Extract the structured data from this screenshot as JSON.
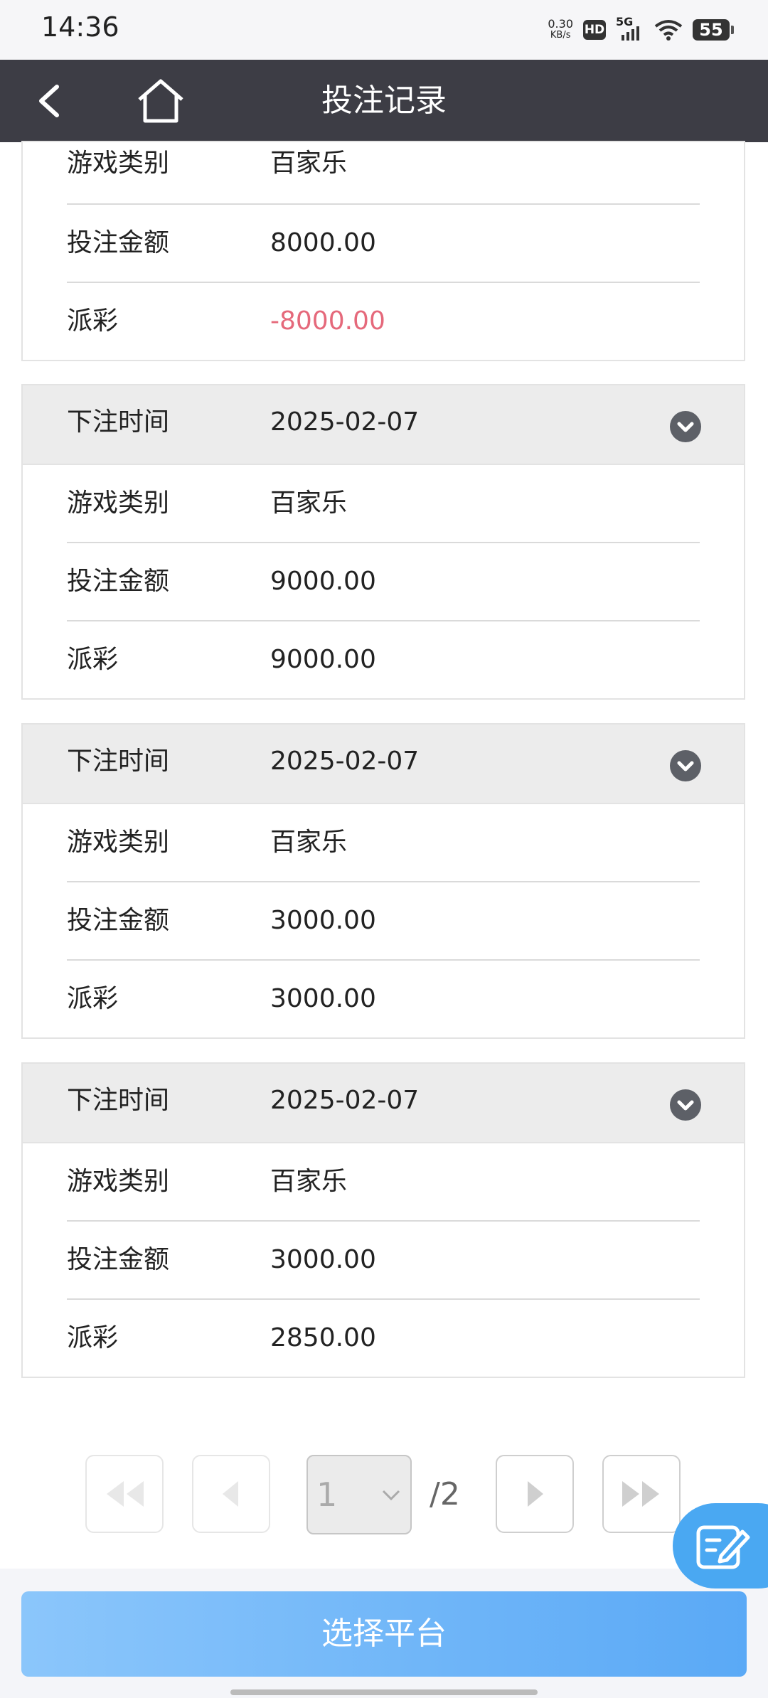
{
  "status_bar": {
    "time": "14:36",
    "net_speed_value": "0.30",
    "net_speed_unit": "KB/s",
    "hd_badge": "HD",
    "network": "5G",
    "battery": "55"
  },
  "header": {
    "title": "投注记录",
    "back_icon": "chevron-left-icon",
    "home_icon": "home-icon"
  },
  "labels": {
    "bet_time": "下注时间",
    "game_type": "游戏类别",
    "bet_amount": "投注金额",
    "payout": "派彩"
  },
  "records": [
    {
      "bet_time": "",
      "game_type": "百家乐",
      "bet_amount": "8000.00",
      "payout": "-8000.00",
      "payout_negative": true
    },
    {
      "bet_time": "2025-02-07",
      "game_type": "百家乐",
      "bet_amount": "9000.00",
      "payout": "9000.00"
    },
    {
      "bet_time": "2025-02-07",
      "game_type": "百家乐",
      "bet_amount": "3000.00",
      "payout": "3000.00"
    },
    {
      "bet_time": "2025-02-07",
      "game_type": "百家乐",
      "bet_amount": "3000.00",
      "payout": "2850.00"
    }
  ],
  "pagination": {
    "current_page": "1",
    "total_pages": "/2"
  },
  "footer": {
    "select_platform": "选择平台"
  },
  "colors": {
    "nav_bg": "#3d3d45",
    "negative": "#e5697b",
    "button_start": "#8bc6fb",
    "button_end": "#5aa9f6",
    "fab": "#4aa8f2"
  }
}
